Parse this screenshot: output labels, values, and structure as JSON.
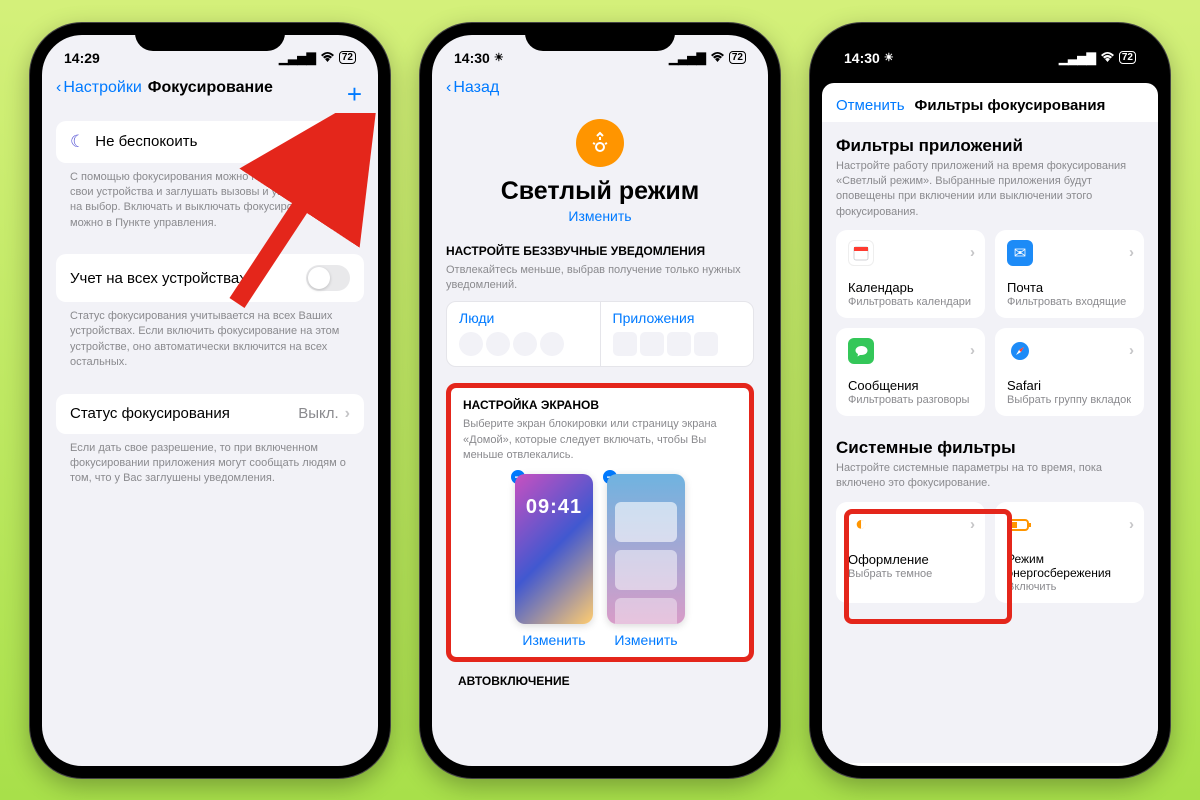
{
  "phone1": {
    "time": "14:29",
    "battery": "72",
    "nav_back": "Настройки",
    "nav_title": "Фокусирование",
    "row_dnd": "Не беспокоить",
    "desc1": "С помощью фокусирования можно гибко настраивать свои устройства и заглушать вызовы и уведомления на выбор. Включать и выключать фокусирования можно в Пункте управления.",
    "row_share": "Учет на всех устройствах",
    "desc2": "Статус фокусирования учитывается на всех Ваших устройствах. Если включить фокусирование на этом устройстве, оно автоматически включится на всех остальных.",
    "row_status": "Статус фокусирования",
    "status_value": "Выкл.",
    "desc3": "Если дать свое разрешение, то при включенном фокусировании приложения могут сообщать людям о том, что у Вас заглушены уведомления."
  },
  "phone2": {
    "time": "14:30",
    "battery": "72",
    "nav_back": "Назад",
    "hero_title": "Светлый режим",
    "hero_link": "Изменить",
    "sec1_title": "НАСТРОЙТЕ БЕЗЗВУЧНЫЕ УВЕДОМЛЕНИЯ",
    "sec1_desc": "Отвлекайтесь меньше, выбрав получение только нужных уведомлений.",
    "people": "Люди",
    "apps": "Приложения",
    "sec2_title": "НАСТРОЙКА ЭКРАНОВ",
    "sec2_desc": "Выберите экран блокировки или страницу экрана «Домой», которые следует включать, чтобы Вы меньше отвлекались.",
    "lock_time": "09:41",
    "change": "Изменить",
    "auto": "АВТОВКЛЮЧЕНИЕ"
  },
  "phone3": {
    "time": "14:30",
    "battery": "72",
    "cancel": "Отменить",
    "modal_title": "Фильтры фокусирования",
    "sec_app_h": "Фильтры приложений",
    "sec_app_desc": "Настройте работу приложений на время фокусирования «Светлый режим». Выбранные приложения будут оповещены при включении или выключении этого фокусирования.",
    "tiles_app": [
      {
        "name": "Календарь",
        "sub": "Фильтровать календари"
      },
      {
        "name": "Почта",
        "sub": "Фильтровать входящие"
      },
      {
        "name": "Сообщения",
        "sub": "Фильтровать разговоры"
      },
      {
        "name": "Safari",
        "sub": "Выбрать группу вкладок"
      }
    ],
    "sec_sys_h": "Системные фильтры",
    "sec_sys_desc": "Настройте системные параметры на то время, пока включено это фокусирование.",
    "tiles_sys": [
      {
        "name": "Оформление",
        "sub": "Выбрать темное"
      },
      {
        "name": "Режим энергосбережения",
        "sub": "Включить"
      }
    ]
  }
}
